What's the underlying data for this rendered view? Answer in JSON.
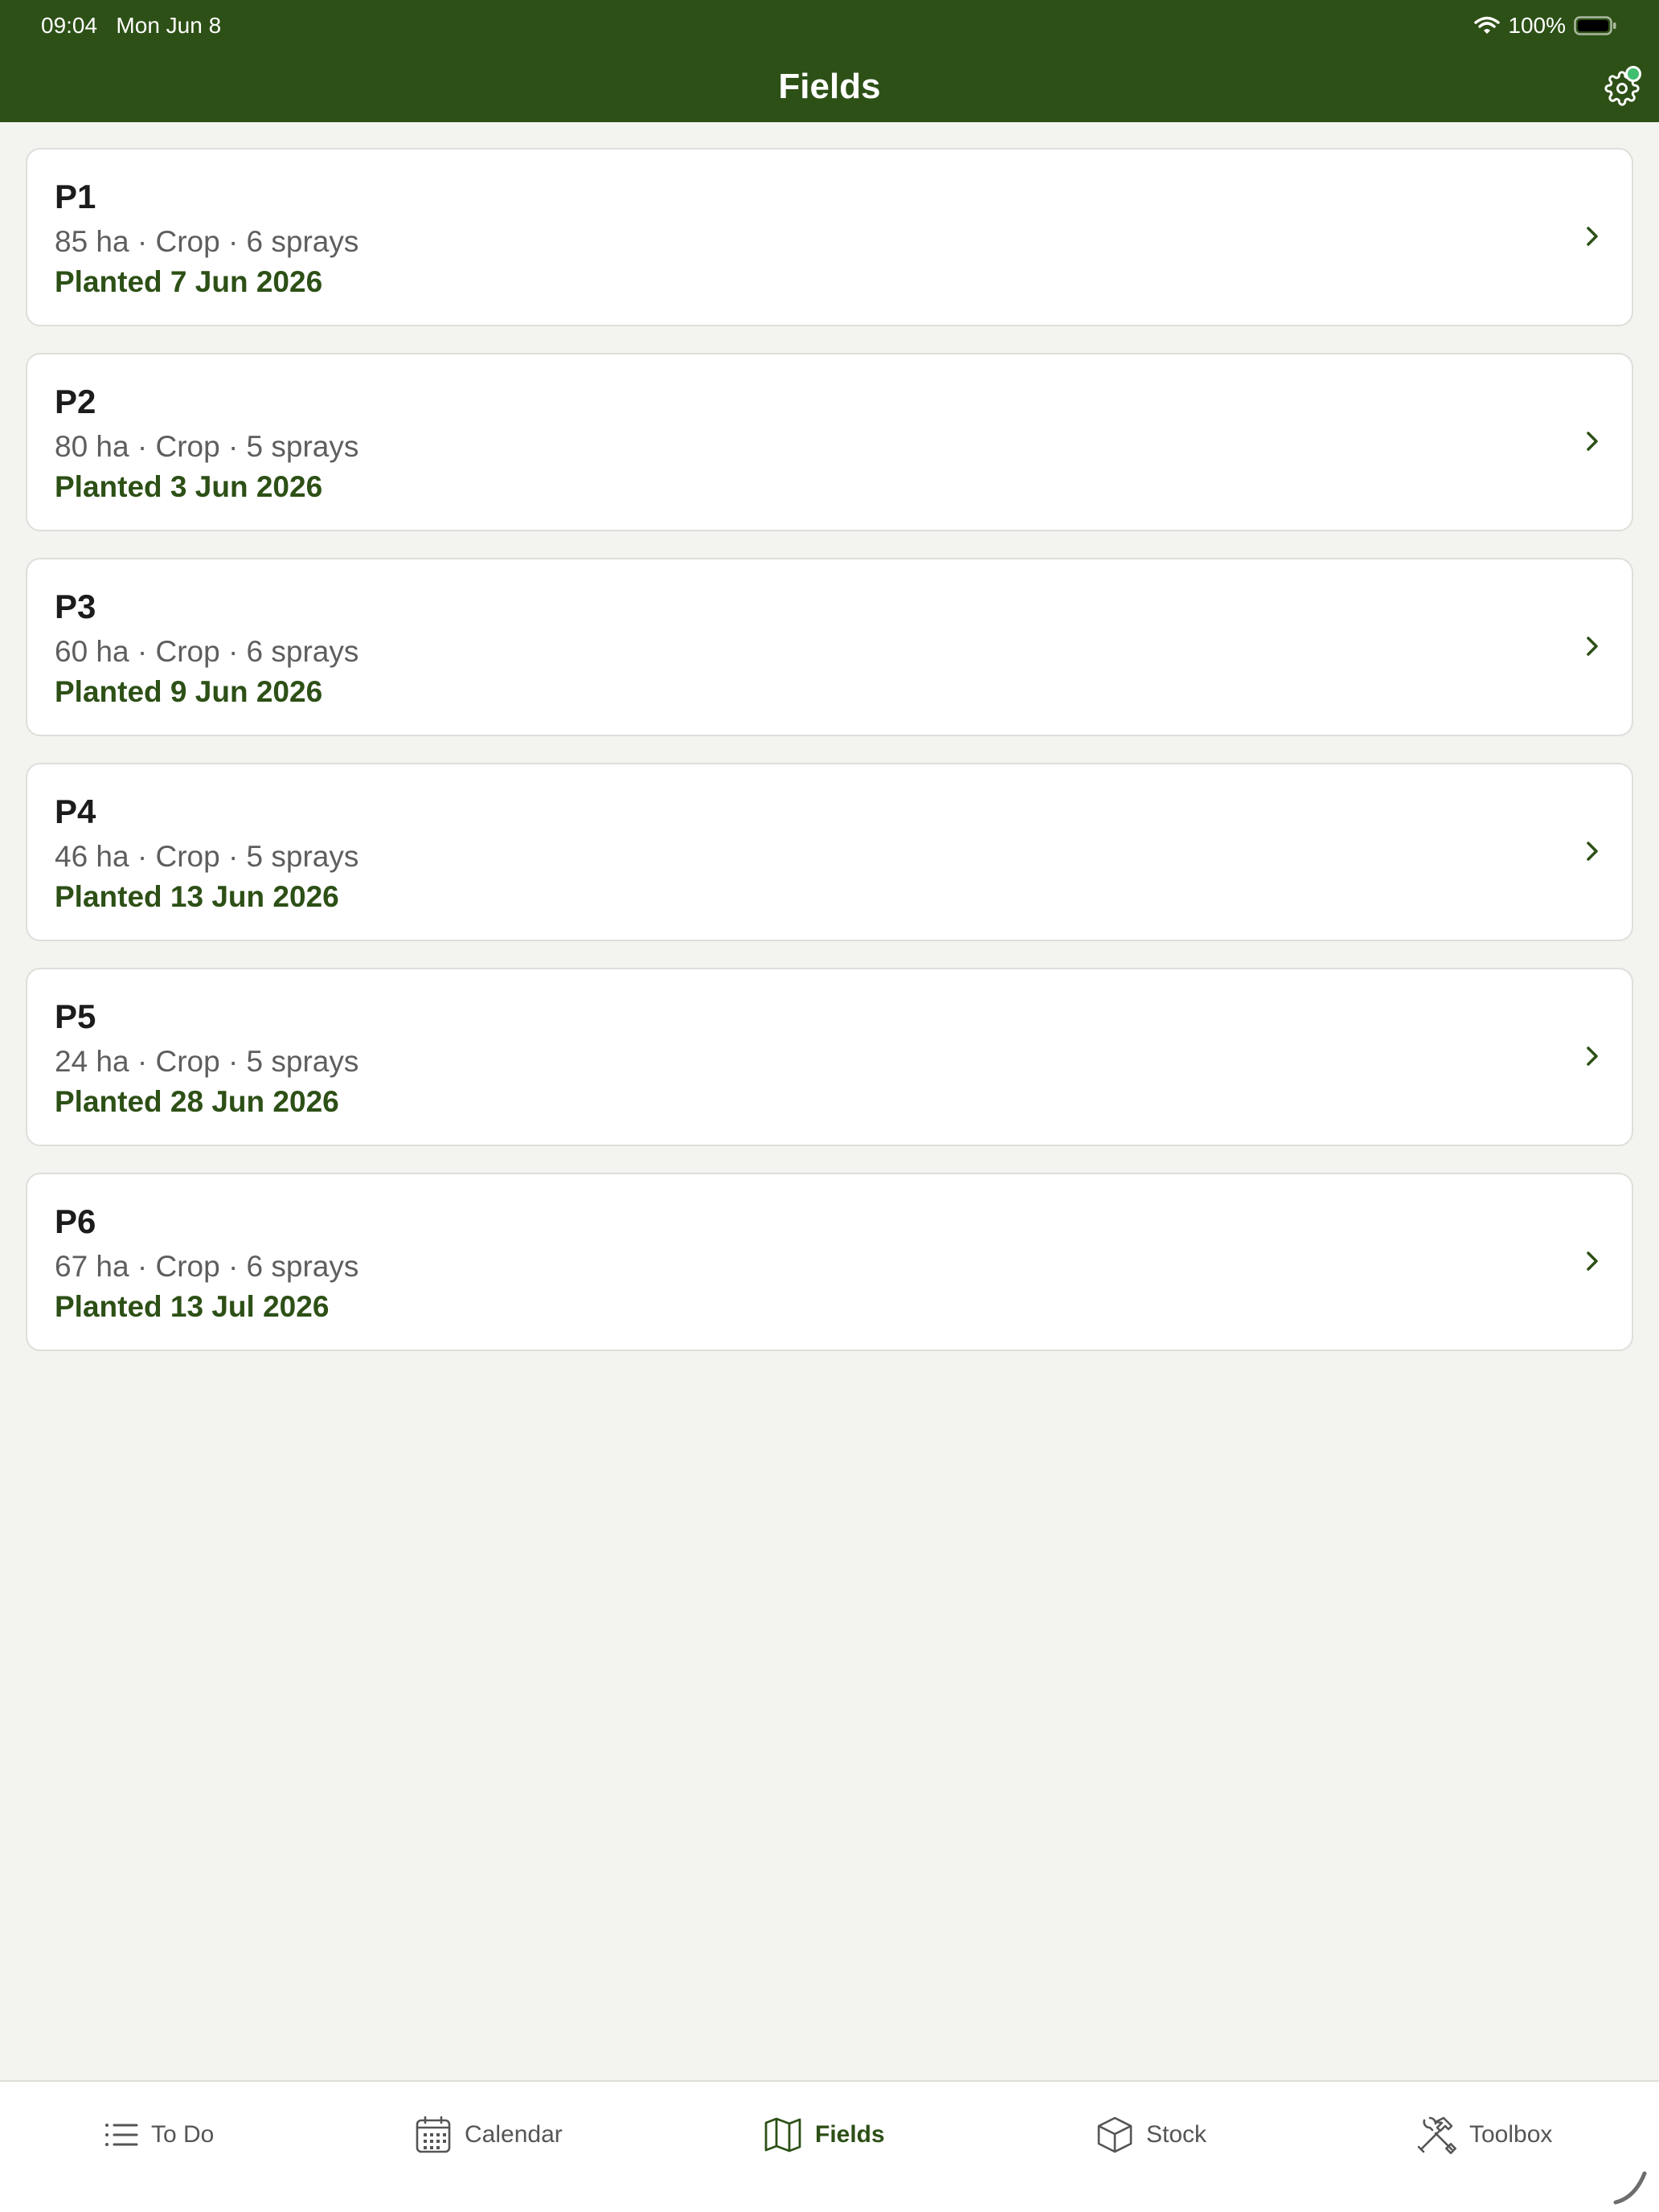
{
  "status_bar": {
    "time": "09:04",
    "date": "Mon Jun 8",
    "battery": "100%"
  },
  "header": {
    "title": "Fields"
  },
  "fields": [
    {
      "name": "P1",
      "details": "85 ha · Crop · 6 sprays",
      "planted": "Planted 7 Jun 2026"
    },
    {
      "name": "P2",
      "details": "80 ha · Crop · 5 sprays",
      "planted": "Planted 3 Jun 2026"
    },
    {
      "name": "P3",
      "details": "60 ha · Crop · 6 sprays",
      "planted": "Planted 9 Jun 2026"
    },
    {
      "name": "P4",
      "details": "46 ha · Crop · 5 sprays",
      "planted": "Planted 13 Jun 2026"
    },
    {
      "name": "P5",
      "details": "24 ha · Crop · 5 sprays",
      "planted": "Planted 28 Jun 2026"
    },
    {
      "name": "P6",
      "details": "67 ha · Crop · 6 sprays",
      "planted": "Planted 13 Jul 2026"
    }
  ],
  "tab_bar": {
    "tabs": [
      {
        "label": "To Do",
        "icon": "list-icon"
      },
      {
        "label": "Calendar",
        "icon": "calendar-icon"
      },
      {
        "label": "Fields",
        "icon": "map-icon",
        "active": true
      },
      {
        "label": "Stock",
        "icon": "box-icon"
      },
      {
        "label": "Toolbox",
        "icon": "tools-icon"
      }
    ]
  },
  "colors": {
    "brand": "#2d5016",
    "background": "#f3f3ef",
    "card": "#ffffff",
    "notification_dot": "#3fbf6f"
  }
}
